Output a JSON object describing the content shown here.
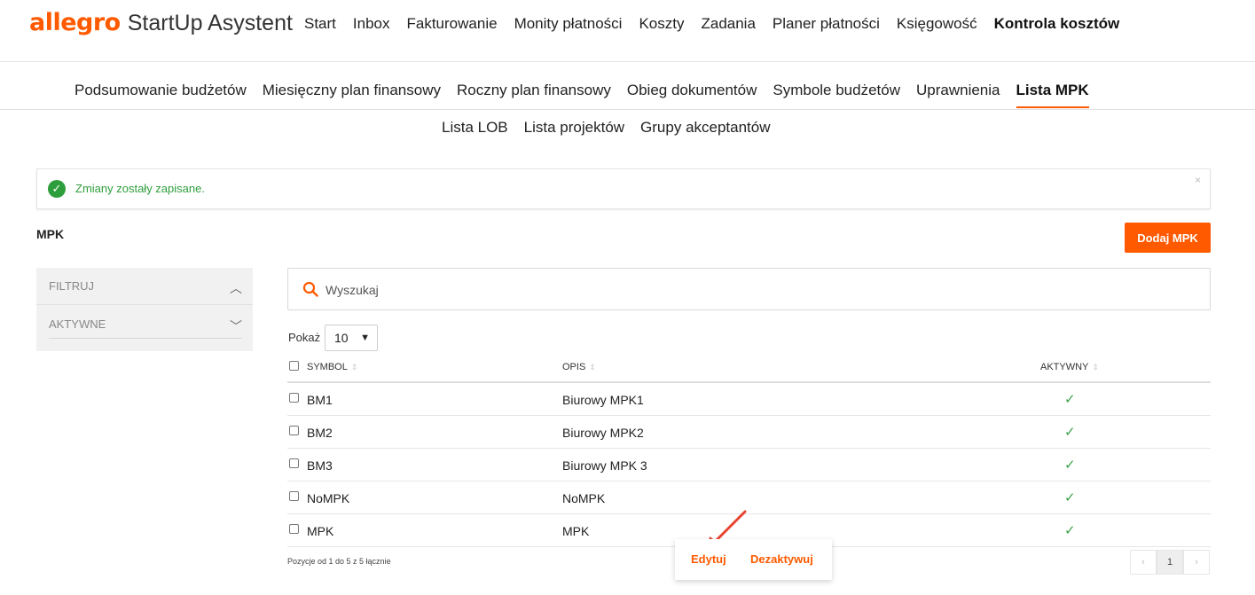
{
  "header": {
    "brand": "allegro",
    "product": "StartUp Asystent",
    "nav": [
      {
        "label": "Start"
      },
      {
        "label": "Inbox"
      },
      {
        "label": "Fakturowanie"
      },
      {
        "label": "Monity płatności"
      },
      {
        "label": "Koszty"
      },
      {
        "label": "Zadania"
      },
      {
        "label": "Planer płatności"
      },
      {
        "label": "Księgowość"
      },
      {
        "label": "Kontrola kosztów",
        "active": true
      }
    ]
  },
  "subnav": [
    {
      "label": "Podsumowanie budżetów"
    },
    {
      "label": "Miesięczny plan finansowy"
    },
    {
      "label": "Roczny plan finansowy"
    },
    {
      "label": "Obieg dokumentów"
    },
    {
      "label": "Symbole budżetów"
    },
    {
      "label": "Uprawnienia"
    },
    {
      "label": "Lista MPK",
      "active": true
    }
  ],
  "subsubnav": [
    {
      "label": "Lista LOB"
    },
    {
      "label": "Lista projektów"
    },
    {
      "label": "Grupy akceptantów"
    }
  ],
  "alert": {
    "text": "Zmiany zostały zapisane.",
    "close": "×"
  },
  "section": {
    "title": "MPK",
    "add_button": "Dodaj MPK"
  },
  "filters": {
    "filter_label": "FILTRUJ",
    "active_label": "AKTYWNE"
  },
  "search": {
    "placeholder": "Wyszukaj"
  },
  "page_size": {
    "label": "Pokaż",
    "value": "10"
  },
  "table": {
    "headers": {
      "symbol": "SYMBOL",
      "opis": "OPIS",
      "aktywny": "AKTYWNY"
    },
    "rows": [
      {
        "symbol": "BM1",
        "opis": "Biurowy MPK1",
        "aktywny": "✓"
      },
      {
        "symbol": "BM2",
        "opis": "Biurowy MPK2",
        "aktywny": "✓"
      },
      {
        "symbol": "BM3",
        "opis": "Biurowy MPK 3",
        "aktywny": "✓"
      },
      {
        "symbol": "NoMPK",
        "opis": "NoMPK",
        "aktywny": "✓"
      },
      {
        "symbol": "MPK",
        "opis": "MPK",
        "aktywny": "✓"
      }
    ],
    "footer": "Pozycje od 1 do 5 z 5 łącznie"
  },
  "pagination": {
    "prev": "‹",
    "current": "1",
    "next": "›"
  },
  "popup": {
    "edit": "Edytuj",
    "deactivate": "Dezaktywuj"
  },
  "colors": {
    "accent": "#ff5a00",
    "success": "#2e9e3c"
  }
}
